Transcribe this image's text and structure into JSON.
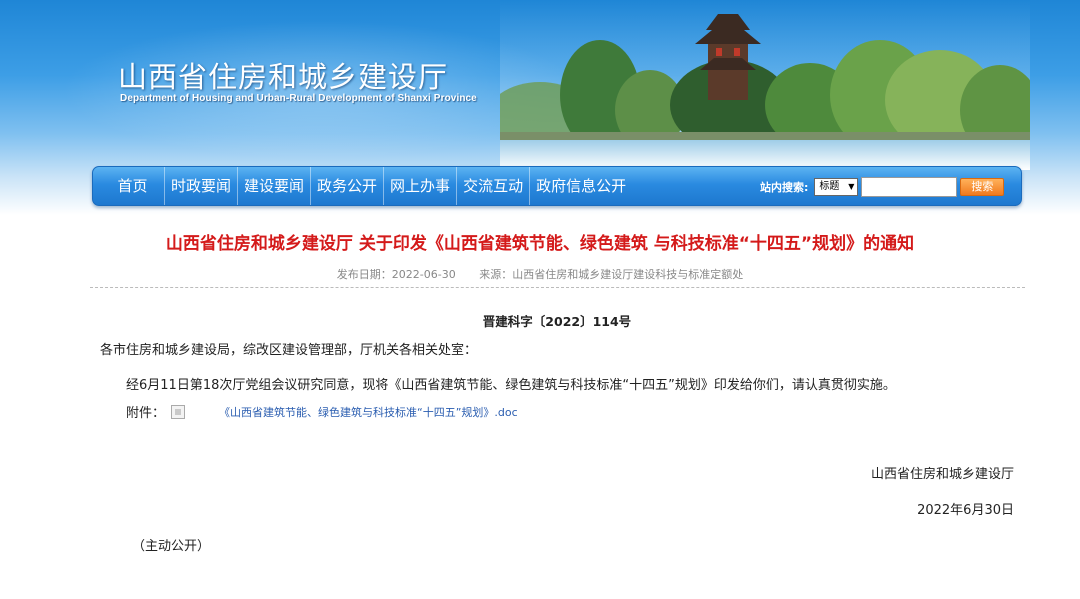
{
  "header": {
    "title": "山西省住房和城乡建设厅",
    "subtitle": "Department of Housing and Urban-Rural Development of Shanxi Province"
  },
  "nav": {
    "items": [
      "首页",
      "时政要闻",
      "建设要闻",
      "政务公开",
      "网上办事",
      "交流互动",
      "政府信息公开"
    ]
  },
  "search": {
    "label": "站内搜索:",
    "select_value": "标题",
    "input_value": "",
    "button_label": "搜索"
  },
  "article": {
    "title": "山西省住房和城乡建设厅 关于印发《山西省建筑节能、绿色建筑 与科技标准“十四五”规划》的通知",
    "publish_date": "发布日期：2022-06-30",
    "source": "来源：山西省住房和城乡建设厅建设科技与标准定额处",
    "doc_number": "晋建科字〔2022〕114号",
    "addressee": "各市住房和城乡建设局，综改区建设管理部，厅机关各相关处室：",
    "body": "经6月11日第18次厅党组会议研究同意，现将《山西省建筑节能、绿色建筑与科技标准“十四五”规划》印发给你们，请认真贯彻实施。",
    "attachment_label": "附件：",
    "attachment_link": "《山西省建筑节能、绿色建筑与科技标准“十四五”规划》.doc",
    "signature_org": "山西省住房和城乡建设厅",
    "signature_date": "2022年6月30日",
    "disclosure": "（主动公开）"
  },
  "colors": {
    "title_red": "#d41a1a",
    "nav_blue": "#2a8ae0",
    "link_blue": "#2a5db0",
    "search_orange": "#f07a1e"
  }
}
